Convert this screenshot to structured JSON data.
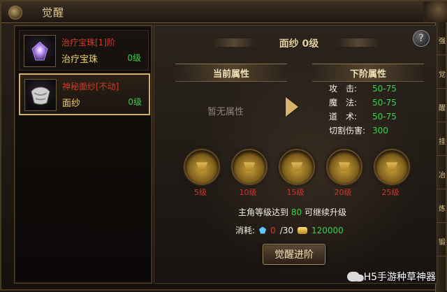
{
  "window": {
    "title": "觉醒"
  },
  "right_tabs": [
    "强",
    "觉",
    "醒",
    "挂",
    "冶",
    "炼",
    "锻"
  ],
  "left_list": {
    "items": [
      {
        "red_text": "治疗宝珠[1]阶",
        "name": "治疗宝珠",
        "level": "0级",
        "icon": "gem-icon"
      },
      {
        "red_text": "神秘面纱[不动]",
        "name": "面纱",
        "level": "0级",
        "icon": "veil-icon"
      }
    ],
    "selected_index": 1
  },
  "main": {
    "header_title": "面纱 0级",
    "current_attr_label": "当前属性",
    "next_attr_label": "下阶属性",
    "no_attr_text": "暂无属性",
    "next_stats": [
      {
        "label": "攻　击:",
        "value": "50-75"
      },
      {
        "label": "魔　法:",
        "value": "50-75"
      },
      {
        "label": "道　术:",
        "value": "50-75"
      },
      {
        "label": "切割伤害:",
        "value": "300"
      }
    ],
    "milestones": [
      "5级",
      "10级",
      "15级",
      "20级",
      "25级"
    ],
    "requirement": {
      "prefix": "主角等级达到",
      "level": "80",
      "suffix": "可继续升级"
    },
    "cost": {
      "label": "消耗:",
      "gem_current": "0",
      "gem_total": "/30",
      "gold": "120000"
    },
    "awaken_button": "觉醒进阶"
  },
  "watermark": {
    "text": "H5手游种草神器"
  }
}
